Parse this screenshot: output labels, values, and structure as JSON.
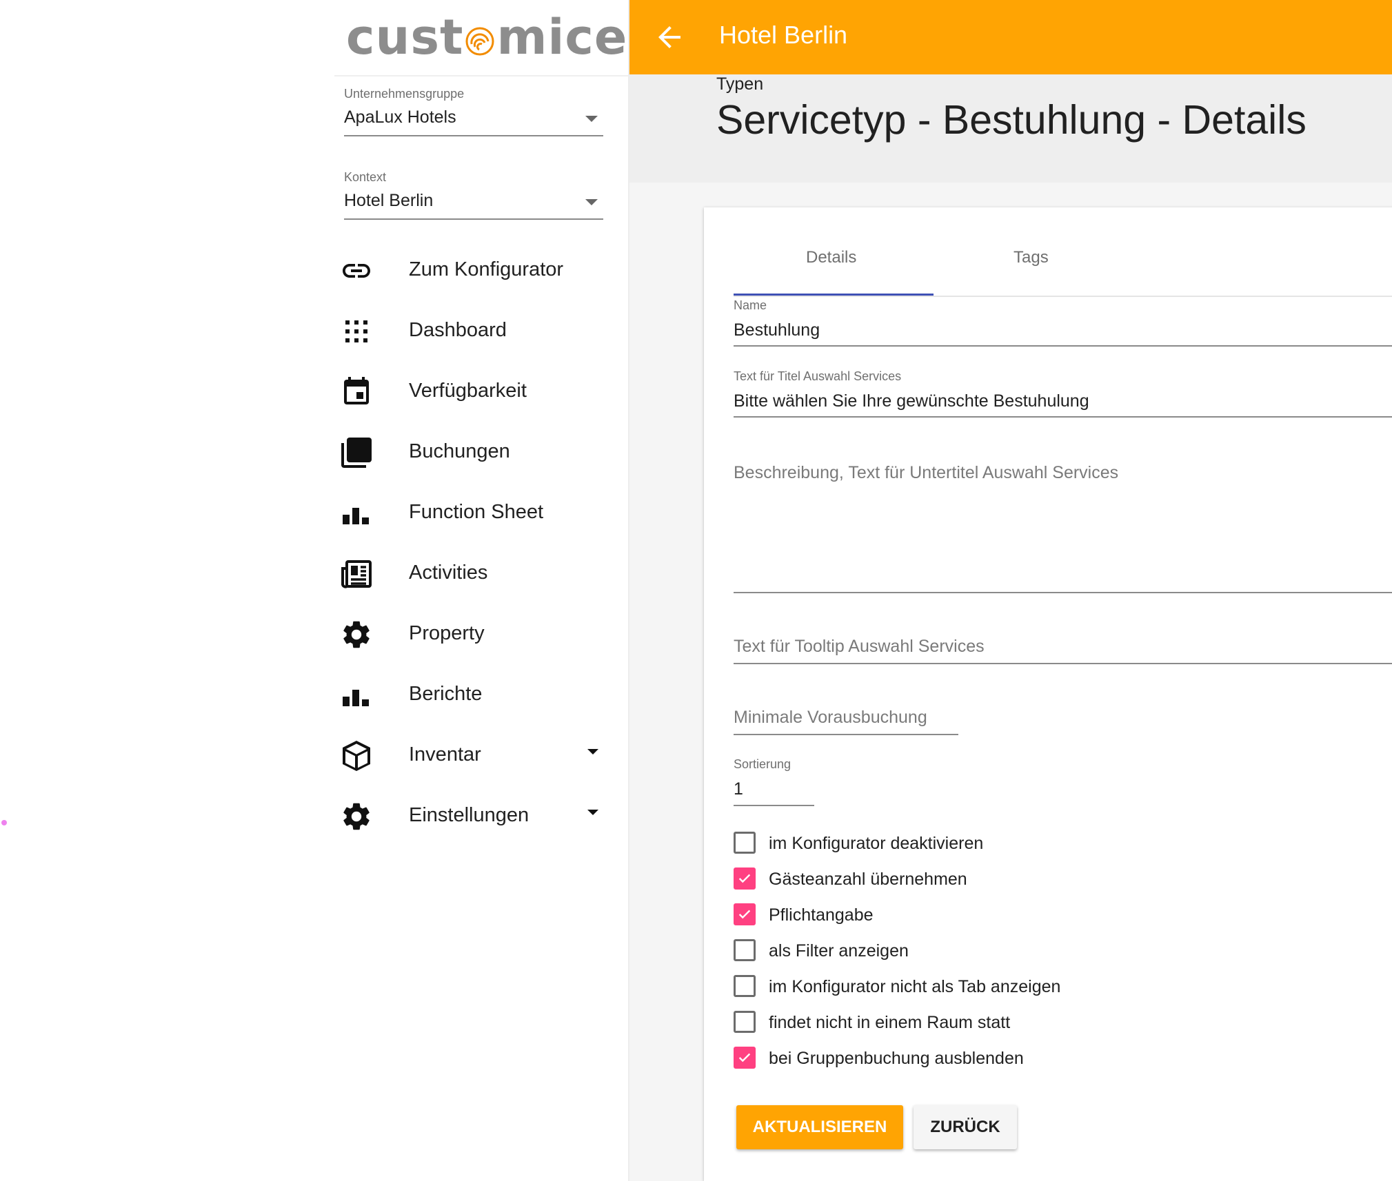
{
  "app": {
    "logo_text_left": "cust",
    "logo_text_right": "mice",
    "accent_color": "#ffa403",
    "checkbox_color": "#ff4081",
    "tab_indicator_color": "#3f51b5"
  },
  "sidebar": {
    "company_group": {
      "label": "Unternehmensgruppe",
      "value": "ApaLux Hotels"
    },
    "context": {
      "label": "Kontext",
      "value": "Hotel Berlin"
    },
    "items": [
      {
        "label": "Zum Konfigurator",
        "icon": "link-icon"
      },
      {
        "label": "Dashboard",
        "icon": "apps-grid-icon"
      },
      {
        "label": "Verfügbarkeit",
        "icon": "calendar-icon"
      },
      {
        "label": "Buchungen",
        "icon": "stacked-pages-icon"
      },
      {
        "label": "Function Sheet",
        "icon": "bar-chart-icon"
      },
      {
        "label": "Activities",
        "icon": "newspaper-icon"
      },
      {
        "label": "Property",
        "icon": "gear-icon"
      },
      {
        "label": "Berichte",
        "icon": "bar-chart-icon"
      },
      {
        "label": "Inventar",
        "icon": "cube-icon",
        "expandable": true
      },
      {
        "label": "Einstellungen",
        "icon": "gear-icon",
        "expandable": true
      }
    ]
  },
  "header": {
    "title": "Hotel Berlin",
    "back_icon": "arrow-back-icon"
  },
  "page": {
    "breadcrumb": "Typen",
    "title": "Servicetyp - Bestuhlung - Details"
  },
  "tabs": [
    {
      "label": "Details",
      "active": true
    },
    {
      "label": "Tags",
      "active": false
    }
  ],
  "form": {
    "name": {
      "label": "Name",
      "value": "Bestuhlung"
    },
    "title_text": {
      "label": "Text für Titel Auswahl Services",
      "value": "Bitte wählen Sie Ihre gewünschte Bestuhulung"
    },
    "description": {
      "placeholder": "Beschreibung, Text für Untertitel Auswahl Services"
    },
    "tooltip": {
      "placeholder": "Text für Tooltip Auswahl Services"
    },
    "min_advance": {
      "placeholder": "Minimale Vorausbuchung"
    },
    "sort": {
      "label": "Sortierung",
      "value": "1"
    },
    "checkboxes": [
      {
        "label": "im Konfigurator deaktivieren",
        "checked": false
      },
      {
        "label": "Gästeanzahl übernehmen",
        "checked": true
      },
      {
        "label": "Pflichtangabe",
        "checked": true
      },
      {
        "label": "als Filter anzeigen",
        "checked": false
      },
      {
        "label": "im Konfigurator nicht als Tab anzeigen",
        "checked": false
      },
      {
        "label": "findet nicht in einem Raum statt",
        "checked": false
      },
      {
        "label": "bei Gruppenbuchung ausblenden",
        "checked": true
      }
    ]
  },
  "buttons": {
    "update": "AKTUALISIEREN",
    "back": "ZURÜCK"
  }
}
